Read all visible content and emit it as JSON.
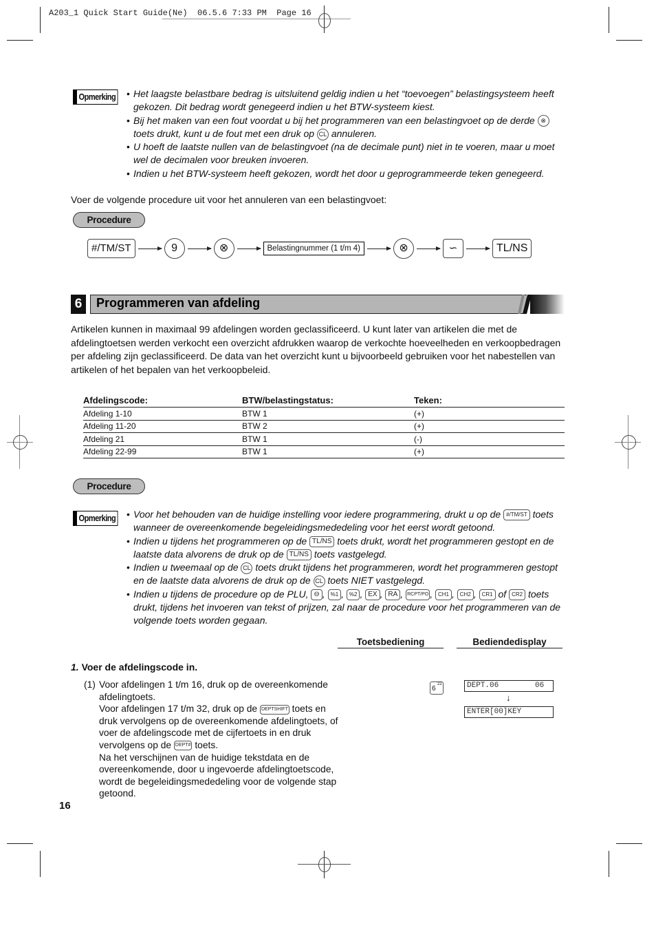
{
  "print_header": "A203_1 Quick Start Guide(Ne)  06.5.6 7:33 PM  Page 16",
  "note1": {
    "badge": "Opmerking",
    "items": [
      "Het laagste belastbare bedrag is uitsluitend geldig indien u het “toevoegen” belastingsysteem heeft gekozen. Dit bedrag wordt genegeerd indien u het BTW-systeem kiest.",
      {
        "pre": "Bij het maken van een fout voordat u bij het programmeren van een belastingvoet op de derde ",
        "key1": "⊗",
        "mid": " toets drukt, kunt u de fout met een druk op ",
        "key2": "CL",
        "post": " annuleren."
      },
      "U hoeft de laatste nullen van de belastingvoet (na de decimale punt) niet in te voeren, maar u moet wel de decimalen voor breuken invoeren.",
      "Indien u het BTW-systeem heeft gekozen, wordt het door u geprogrammeerde teken genegeerd."
    ]
  },
  "cancel_intro": "Voer de volgende procedure uit voor het annuleren van een belastingvoet:",
  "procedure_label": "Procedure",
  "sequence": [
    {
      "type": "key",
      "label": "#/TM/ST"
    },
    {
      "type": "circle",
      "label": "9"
    },
    {
      "type": "circle",
      "label": "⊗"
    },
    {
      "type": "box",
      "label": "Belastingnummer (1 t/m 4)"
    },
    {
      "type": "circle",
      "label": "⊗"
    },
    {
      "type": "key",
      "label": "∽"
    },
    {
      "type": "key",
      "label": "TL/NS"
    }
  ],
  "section": {
    "number": "6",
    "title": "Programmeren van afdeling",
    "intro": "Artikelen kunnen in maximaal 99 afdelingen worden geclassificeerd. U kunt later van artikelen die met de afdelingtoetsen werden verkocht een overzicht afdrukken waarop de verkochte hoeveelheden en verkoopbedragen per afdeling zijn geclassificeerd. De data van het overzicht kunt u bijvoorbeeld gebruiken voor het nabestellen van artikelen of het bepalen van het verkoopbeleid."
  },
  "dept_table": {
    "headers": [
      "Afdelingscode:",
      "BTW/belastingstatus:",
      "Teken:"
    ],
    "rows": [
      [
        "Afdeling 1-10",
        "BTW 1",
        "(+)"
      ],
      [
        "Afdeling 11-20",
        "BTW 2",
        "(+)"
      ],
      [
        "Afdeling 21",
        "BTW 1",
        "(-)"
      ],
      [
        "Afdeling 22-99",
        "BTW 1",
        "(+)"
      ]
    ]
  },
  "note2": {
    "badge": "Opmerking",
    "b1_pre": "Voor het behouden van de huidige instelling voor iedere programmering, drukt u op de ",
    "b1_key": "#/TM/ST",
    "b1_post": " toets wanneer de overeenkomende begeleidingsmededeling voor het eerst wordt getoond.",
    "b2_pre": "Indien u tijdens het programmeren op de ",
    "b2_key": "TL/NS",
    "b2_mid": " toets drukt, wordt het programmeren gestopt en de laatste data alvorens de druk op de ",
    "b2_key2": "TL/NS",
    "b2_post": " toets vastgelegd.",
    "b3_pre": "Indien u tweemaal op de ",
    "b3_key": "CL",
    "b3_mid": " toets drukt tijdens het programmeren, wordt het programmeren gestopt en de laatste data alvorens de druk op de ",
    "b3_key2": "CL",
    "b3_post": " toets NIET vastgelegd.",
    "b4_pre": "Indien u tijdens de procedure op de PLU, ",
    "b4_keys": [
      "⊖",
      "%1",
      "%2",
      "EX",
      "RA",
      "RCPT/PO",
      "CH1",
      "CH2",
      "CR1"
    ],
    "b4_of": " of ",
    "b4_lastkey": "CR2",
    "b4_post": " toets drukt, tijdens het invoeren van tekst of prijzen, zal naar de procedure voor het programmeren van de volgende toets worden gegaan."
  },
  "columns": {
    "keyop": "Toetsbediening",
    "display": "Bediendedisplay"
  },
  "step1": {
    "num": "1.",
    "title": "Voer de afdelingscode in.",
    "sub": "(1)",
    "l1": "Voor afdelingen 1 t/m 16, druk op de overeenkomende afdelingtoets.",
    "l2_pre": "Voor afdelingen 17 t/m 32, druk op de ",
    "l2_key": "DEPTSHIFT",
    "l2_post": " toets en druk vervolgens op de overeenkomende afdelingtoets, of voer de afdelingscode met de cijfertoets in en druk vervolgens op de ",
    "l2_key2": "DEPT#",
    "l2_end": " toets.",
    "l3": "Na het verschijnen van de huidige tekstdata en de overeenkomende, door u ingevoerde afdelingtoetscode, wordt de begeleidingsmededeling voor de volgende stap getoond.",
    "key_main": "6",
    "key_sup": "22",
    "lcd1": "DEPT.06        06",
    "lcd_arrow": "↓",
    "lcd2": "ENTER[00]KEY"
  },
  "page_number": "16"
}
